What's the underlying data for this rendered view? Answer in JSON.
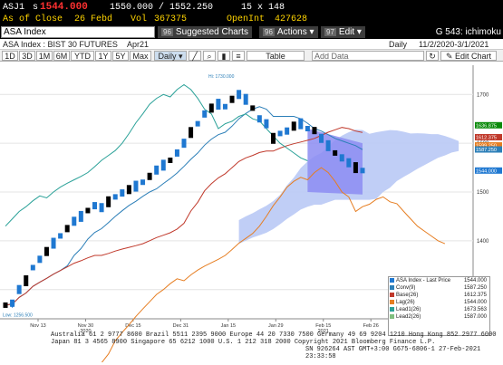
{
  "quote": {
    "ticker": "ASJ1",
    "bid_prefix": "s",
    "last": "1544.000",
    "range": "1550.000 / 1552.250",
    "size": "15 x 148",
    "asof_label": "As of Close",
    "asof_date": "26 Febd",
    "vol_label": "Vol",
    "vol": "367375",
    "openint_label": "OpenInt",
    "openint": "427628"
  },
  "tickerbar": {
    "security": "ASA Index",
    "menus": [
      {
        "num": "96",
        "label": "Suggested Charts"
      },
      {
        "num": "96",
        "label": "Actions"
      },
      {
        "num": "97",
        "label": "Edit"
      }
    ],
    "chart_name": "G 543: ichimoku"
  },
  "secrow": {
    "desc": "ASA Index : BIST 30 FUTURES",
    "contract": "Apr21",
    "period": "Daily",
    "range": "11/2/2020-3/1/2021"
  },
  "toolbar": {
    "periods": [
      "1D",
      "3D",
      "1M",
      "6M",
      "YTD",
      "1Y",
      "5Y",
      "Max"
    ],
    "freq": "Daily",
    "table_label": "Table",
    "add_data_label": "Add Data",
    "edit_chart_label": "Edit Chart"
  },
  "chart_data": {
    "type": "candlestick",
    "title": "",
    "y_ticks": [
      1300,
      1400,
      1500,
      1600,
      1700
    ],
    "ylim": [
      1240,
      1760
    ],
    "x_ticks": [
      "Nov 13",
      "Nov 30",
      "Dec 15",
      "Dec 31",
      "Jan 15",
      "Jan 29",
      "Feb 15",
      "Feb 26",
      "Mar 15",
      "Mar 31"
    ],
    "x_year_labels": {
      "Nov 30": "2020",
      "Feb 15": "2021"
    },
    "annotations": {
      "high": "Hi: 1730.000",
      "low": "Low: 1256.500"
    },
    "price": [
      1268,
      1272,
      1300,
      1318,
      1345,
      1362,
      1378,
      1395,
      1410,
      1425,
      1440,
      1450,
      1462,
      1472,
      1468,
      1480,
      1490,
      1498,
      1505,
      1512,
      1520,
      1532,
      1545,
      1555,
      1565,
      1580,
      1600,
      1622,
      1640,
      1660,
      1672,
      1680,
      1675,
      1690,
      1700,
      1690,
      1672,
      1650,
      1640,
      1610,
      1620,
      1625,
      1635,
      1640,
      1630,
      1626,
      1610,
      1595,
      1580,
      1570,
      1560,
      1550,
      1544
    ],
    "price_labels": [
      {
        "text": "1636.875",
        "value": 1636.875,
        "color": "#0a8a0a"
      },
      {
        "text": "1612.375",
        "value": 1612.375,
        "color": "#c0392b"
      },
      {
        "text": "1599.250",
        "value": 1599.25,
        "color": "#e67e22"
      },
      {
        "text": "1587.250",
        "value": 1587.25,
        "color": "#2c7fb8"
      },
      {
        "text": "1544.000",
        "value": 1544.0,
        "color": "#1f78d1"
      }
    ],
    "legend": [
      {
        "name": "ASA Index - Last Price",
        "value": "1544.000",
        "color": "#1f78d1"
      },
      {
        "name": "Conv(9)",
        "value": "1587.250",
        "color": "#2c7fb8"
      },
      {
        "name": "Base(26)",
        "value": "1612.375",
        "color": "#c0392b"
      },
      {
        "name": "Lag(26)",
        "value": "1544.000",
        "color": "#e67e22"
      },
      {
        "name": "Lead1(26)",
        "value": "1673.563",
        "color": "#2aa198"
      },
      {
        "name": "Lead2(26)",
        "value": "1587.000",
        "color": "#7fbf7f"
      }
    ]
  },
  "footer": {
    "line1": "Australia 61 2 9777 8600 Brazil 5511 2395 9000 Europe 44 20 7330 7500 Germany 49 69 9204 1210 Hong Kong 852 2977 6000",
    "line2": "Japan 81 3 4565 8900       Singapore 65 6212 1000    U.S. 1 212 318 2000       Copyright 2021 Bloomberg Finance L.P.",
    "line3": "SN 926264 AST  GMT+3:00 G675-6806-1 27-Feb-2021 23:33:58"
  }
}
